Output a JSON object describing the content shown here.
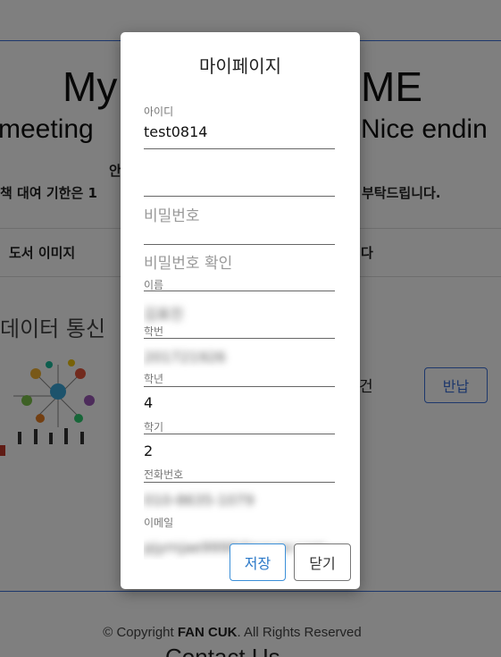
{
  "background": {
    "title_left": "My",
    "title_right": "ME",
    "subtitle_left": "meeting",
    "subtitle_right": "Nice endin",
    "notice_a": "안",
    "notice_left": "책 대여 기한은 1",
    "notice_right": "부탁드립니다.",
    "table_header_left": "도서 이미지",
    "table_header_right": "다",
    "book_title": "데이터 통신",
    "count_text": "건",
    "return_button": "반납",
    "copyright_prefix": "© Copyright ",
    "copyright_brand": "FAN CUK",
    "copyright_suffix": ". All Rights Reserved",
    "contact": "Contact Us"
  },
  "modal": {
    "title": "마이페이지",
    "fields": {
      "id": {
        "label": "아이디",
        "value": "test0814"
      },
      "password": {
        "placeholder": "비밀번호"
      },
      "password_confirm": {
        "placeholder": "비밀번호 확인"
      },
      "name": {
        "label": "이름",
        "value": "김표진"
      },
      "student_id": {
        "label": "학번",
        "value": "201721926"
      },
      "grade": {
        "label": "학년",
        "value": "4"
      },
      "semester": {
        "label": "학기",
        "value": "2"
      },
      "phone": {
        "label": "전화번호",
        "value": "010-8635-1079"
      },
      "email": {
        "label": "이메일",
        "value": "pjyrnjae9999@naver.com"
      }
    },
    "save_button": "저장",
    "close_button": "닫기"
  },
  "colors": {
    "accent": "#3b6fd8",
    "backdrop": "rgba(0,0,0,0.5)"
  }
}
